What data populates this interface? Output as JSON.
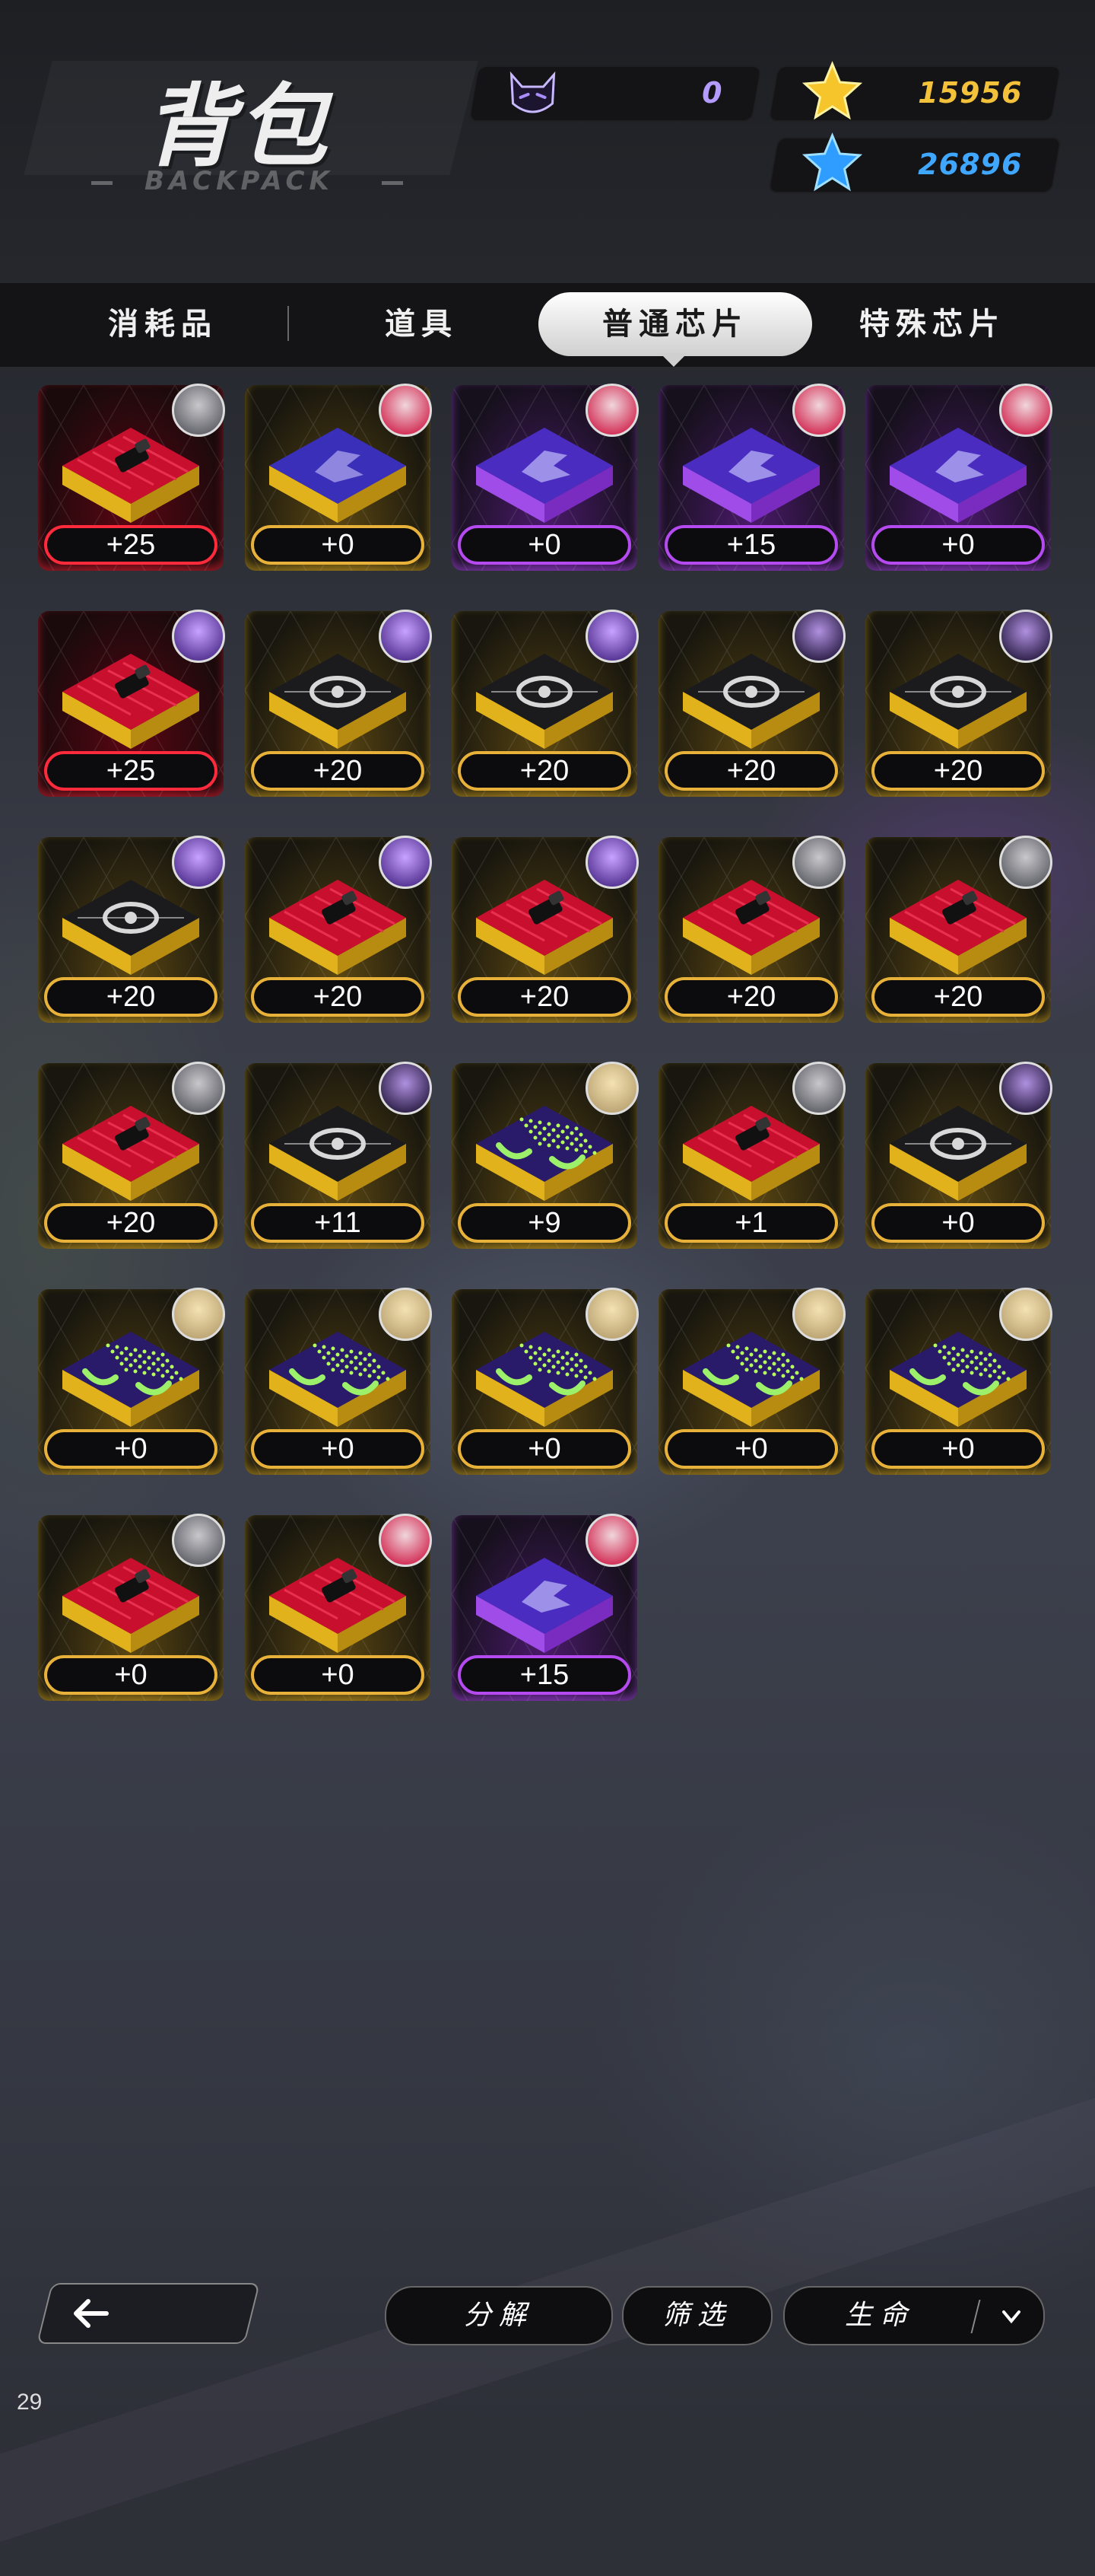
{
  "header": {
    "title": "背包",
    "subtitle": "BACKPACK",
    "currencies": [
      {
        "id": "cat-token",
        "value": "0",
        "color": "#b49cff",
        "icon": "cat-head-icon"
      },
      {
        "id": "gold-star",
        "value": "15956",
        "color": "#f3c13a",
        "icon": "gold-star-icon"
      },
      {
        "id": "blue-star",
        "value": "26896",
        "color": "#3fa7ff",
        "icon": "blue-star-icon"
      }
    ]
  },
  "tabs": [
    {
      "label": "消耗品",
      "active": false
    },
    {
      "label": "道具",
      "active": false
    },
    {
      "label": "普通芯片",
      "active": true
    },
    {
      "label": "特殊芯片",
      "active": false
    }
  ],
  "chips": [
    {
      "level": "+25",
      "rarity": "red",
      "chip": "lipstick",
      "avatar": "silver"
    },
    {
      "level": "+0",
      "rarity": "gold",
      "chip": "logo-blue",
      "avatar": "pinkred"
    },
    {
      "level": "+0",
      "rarity": "purple",
      "chip": "logo-purple",
      "avatar": "pinkred"
    },
    {
      "level": "+15",
      "rarity": "purple",
      "chip": "logo-purple",
      "avatar": "pinkred"
    },
    {
      "level": "+0",
      "rarity": "purple",
      "chip": "logo-purple",
      "avatar": "pinkred"
    },
    {
      "level": "+25",
      "rarity": "red",
      "chip": "lipstick",
      "avatar": "violet"
    },
    {
      "level": "+20",
      "rarity": "gold",
      "chip": "eye",
      "avatar": "violet"
    },
    {
      "level": "+20",
      "rarity": "gold",
      "chip": "eye",
      "avatar": "violet"
    },
    {
      "level": "+20",
      "rarity": "gold",
      "chip": "eye",
      "avatar": "violetdark"
    },
    {
      "level": "+20",
      "rarity": "gold",
      "chip": "eye",
      "avatar": "violetdark"
    },
    {
      "level": "+20",
      "rarity": "gold",
      "chip": "eye",
      "avatar": "violet"
    },
    {
      "level": "+20",
      "rarity": "gold",
      "chip": "lipstick",
      "avatar": "violet"
    },
    {
      "level": "+20",
      "rarity": "gold",
      "chip": "lipstick",
      "avatar": "violet"
    },
    {
      "level": "+20",
      "rarity": "gold",
      "chip": "lipstick",
      "avatar": "silver"
    },
    {
      "level": "+20",
      "rarity": "gold",
      "chip": "lipstick",
      "avatar": "silver"
    },
    {
      "level": "+20",
      "rarity": "gold",
      "chip": "lipstick",
      "avatar": "silver"
    },
    {
      "level": "+11",
      "rarity": "gold",
      "chip": "eye",
      "avatar": "violetdark"
    },
    {
      "level": "+9",
      "rarity": "gold",
      "chip": "grid-green",
      "avatar": "blonde"
    },
    {
      "level": "+1",
      "rarity": "gold",
      "chip": "lipstick",
      "avatar": "silver"
    },
    {
      "level": "+0",
      "rarity": "gold",
      "chip": "eye",
      "avatar": "violetdark"
    },
    {
      "level": "+0",
      "rarity": "gold",
      "chip": "grid-green",
      "avatar": "blonde"
    },
    {
      "level": "+0",
      "rarity": "gold",
      "chip": "grid-green",
      "avatar": "blonde"
    },
    {
      "level": "+0",
      "rarity": "gold",
      "chip": "grid-green",
      "avatar": "blonde"
    },
    {
      "level": "+0",
      "rarity": "gold",
      "chip": "grid-green",
      "avatar": "blonde"
    },
    {
      "level": "+0",
      "rarity": "gold",
      "chip": "grid-green",
      "avatar": "blonde"
    },
    {
      "level": "+0",
      "rarity": "gold",
      "chip": "lipstick",
      "avatar": "silver"
    },
    {
      "level": "+0",
      "rarity": "gold",
      "chip": "lipstick",
      "avatar": "pinkred"
    },
    {
      "level": "+15",
      "rarity": "purple",
      "chip": "logo-purple",
      "avatar": "pinkred"
    }
  ],
  "footer": {
    "back_icon": "back-arrow-icon",
    "decompose_label": "分解",
    "filter_label": "筛选",
    "sort_label": "生命",
    "sort_icon": "chevron-down-icon"
  },
  "page_number": "29"
}
